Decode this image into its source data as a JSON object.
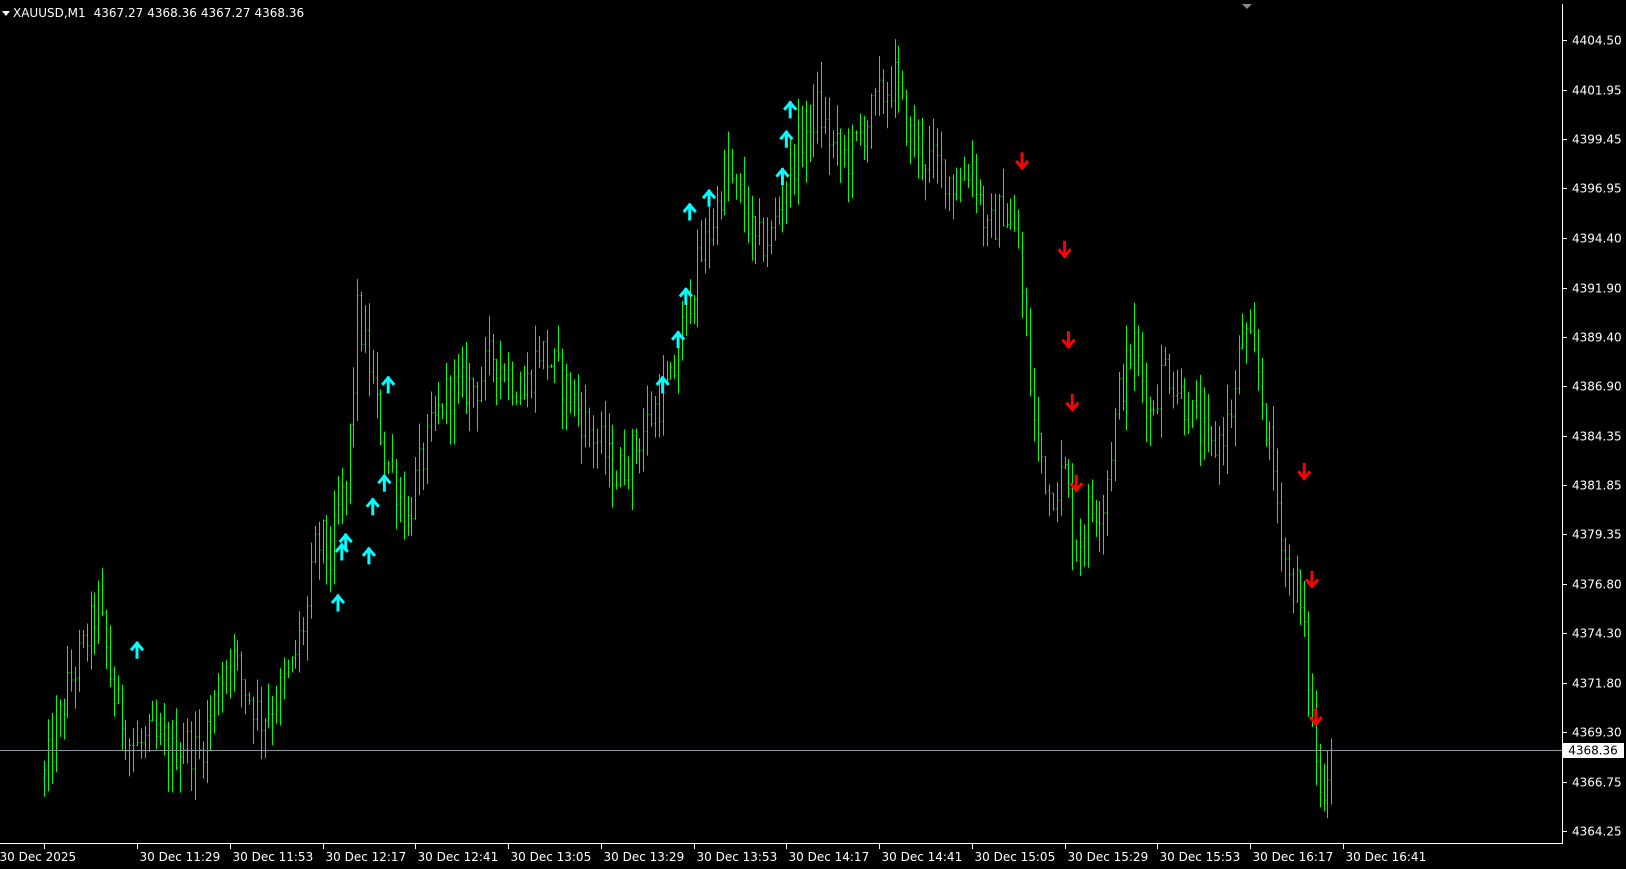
{
  "header": {
    "symbol": "XAUUSD,M1",
    "open": "4367.27",
    "high": "4368.36",
    "low": "4367.27",
    "close": "4368.36"
  },
  "current_price_label": "4368.36",
  "colors": {
    "background": "#000000",
    "candle": "#00ff00",
    "axis": "#ffffff",
    "buy_arrow": "#00ffff",
    "sell_arrow": "#ff0000",
    "bid_line": "#8c9aa0"
  },
  "chart_data": {
    "type": "candlestick",
    "symbol": "XAUUSD",
    "timeframe": "M1",
    "y_ticks": [
      4404.5,
      4401.95,
      4399.45,
      4396.95,
      4394.4,
      4391.9,
      4389.4,
      4386.9,
      4384.35,
      4381.85,
      4379.35,
      4376.8,
      4374.3,
      4371.8,
      4369.3,
      4366.75,
      4364.25
    ],
    "y_tick_labels": [
      "4404.50",
      "4401.95",
      "4399.45",
      "4396.95",
      "4394.40",
      "4391.90",
      "4389.40",
      "4386.90",
      "4384.35",
      "4381.85",
      "4379.35",
      "4376.80",
      "4374.30",
      "4371.80",
      "4369.30",
      "4366.75",
      "4364.25"
    ],
    "x_tick_labels": [
      "30 Dec 2025",
      "30 Dec 11:29",
      "30 Dec 11:53",
      "30 Dec 12:17",
      "30 Dec 12:41",
      "30 Dec 13:05",
      "30 Dec 13:29",
      "30 Dec 13:53",
      "30 Dec 14:17",
      "30 Dec 14:41",
      "30 Dec 15:05",
      "30 Dec 15:29",
      "30 Dec 15:53",
      "30 Dec 16:17",
      "30 Dec 16:41"
    ],
    "x_tick_minutes": [
      -24,
      0,
      24,
      48,
      72,
      96,
      120,
      144,
      168,
      192,
      216,
      240,
      264,
      288,
      312
    ],
    "ylim": [
      4363.8,
      4405.4
    ],
    "current_bid": 4368.36,
    "price_path_minutes": [
      -24,
      -18,
      -14,
      -10,
      -6,
      -4,
      -2,
      0,
      4,
      8,
      12,
      16,
      20,
      24,
      28,
      32,
      36,
      40,
      44,
      46,
      48,
      50,
      52,
      54,
      56,
      57,
      60,
      64,
      66,
      70,
      72,
      76,
      80,
      84,
      88,
      92,
      96,
      100,
      104,
      108,
      112,
      116,
      120,
      124,
      128,
      132,
      136,
      138,
      140,
      142,
      146,
      150,
      152,
      156,
      160,
      164,
      168,
      172,
      176,
      180,
      184,
      192,
      196,
      200,
      204,
      208,
      212,
      216,
      220,
      224,
      228,
      230,
      232,
      236,
      240,
      243,
      246,
      250,
      254,
      258,
      262,
      266,
      270,
      274,
      278,
      282,
      284,
      286,
      290,
      294,
      296,
      298,
      300,
      302,
      304,
      306,
      308,
      309
    ],
    "price_path_values": [
      4367.0,
      4371.5,
      4373.5,
      4375.8,
      4371.0,
      4370.0,
      4368.8,
      4368.5,
      4369.0,
      4368.0,
      4368.8,
      4368.2,
      4370.8,
      4373.5,
      4371.5,
      4370.0,
      4371.0,
      4372.5,
      4375.5,
      4378.5,
      4379.0,
      4378.0,
      4380.5,
      4381.8,
      4387.0,
      4390.5,
      4388.0,
      4383.5,
      4382.5,
      4380.0,
      4382.0,
      4384.5,
      4386.5,
      4386.8,
      4387.0,
      4388.5,
      4387.5,
      4386.5,
      4388.8,
      4387.8,
      4386.5,
      4385.0,
      4383.8,
      4382.3,
      4383.5,
      4385.0,
      4386.5,
      4386.9,
      4388.5,
      4391.0,
      4393.5,
      4396.0,
      4397.8,
      4396.5,
      4394.0,
      4394.5,
      4397.5,
      4399.5,
      4401.0,
      4399.0,
      4398.5,
      4401.5,
      4402.5,
      4399.5,
      4398.5,
      4398.0,
      4397.0,
      4398.3,
      4394.5,
      4396.0,
      4394.0,
      4389.0,
      4385.0,
      4381.5,
      4382.5,
      4378.5,
      4380.5,
      4381.0,
      4386.5,
      4389.0,
      4385.5,
      4388.0,
      4386.5,
      4385.0,
      4383.5,
      4385.0,
      4386.5,
      4389.8,
      4387.5,
      4382.5,
      4379.5,
      4377.0,
      4376.8,
      4374.0,
      4370.0,
      4366.0,
      4367.5,
      4368.4
    ],
    "buy_signals": [
      {
        "t": 0,
        "price": 4373.5
      },
      {
        "t": 52,
        "price": 4375.9
      },
      {
        "t": 53,
        "price": 4378.5
      },
      {
        "t": 54,
        "price": 4379.0
      },
      {
        "t": 60,
        "price": 4378.3
      },
      {
        "t": 61,
        "price": 4380.8
      },
      {
        "t": 64,
        "price": 4382.0
      },
      {
        "t": 65,
        "price": 4387.0
      },
      {
        "t": 136,
        "price": 4387.0
      },
      {
        "t": 140,
        "price": 4389.3
      },
      {
        "t": 142,
        "price": 4391.5
      },
      {
        "t": 143,
        "price": 4395.8
      },
      {
        "t": 148,
        "price": 4396.5
      },
      {
        "t": 167,
        "price": 4397.6
      },
      {
        "t": 168,
        "price": 4399.5
      },
      {
        "t": 169,
        "price": 4401.0
      }
    ],
    "sell_signals": [
      {
        "t": 229,
        "price": 4398.3
      },
      {
        "t": 240,
        "price": 4393.8
      },
      {
        "t": 241,
        "price": 4389.2
      },
      {
        "t": 242,
        "price": 4386.0
      },
      {
        "t": 243,
        "price": 4381.9
      },
      {
        "t": 302,
        "price": 4382.5
      },
      {
        "t": 304,
        "price": 4377.0
      },
      {
        "t": 305,
        "price": 4370.0
      }
    ]
  }
}
